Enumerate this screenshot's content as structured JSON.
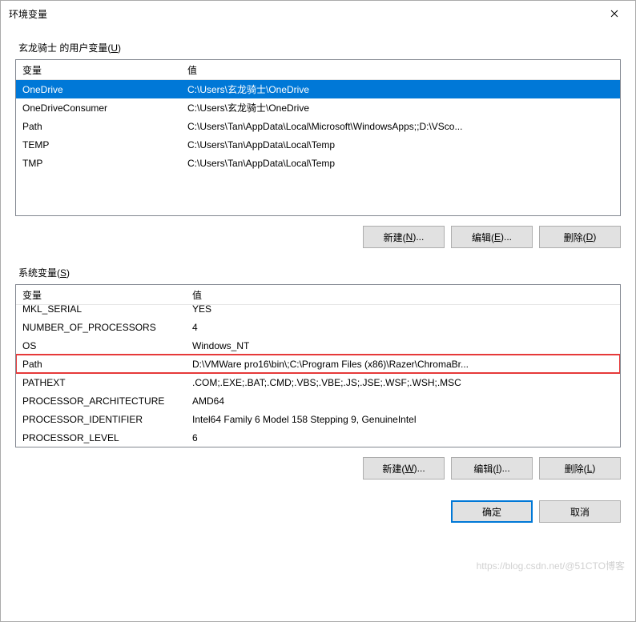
{
  "window": {
    "title": "环境变量"
  },
  "user_section": {
    "label_prefix": "玄龙骑士 的用户变量(",
    "label_hotkey": "U",
    "label_suffix": ")",
    "columns": {
      "var": "变量",
      "val": "值"
    },
    "rows": [
      {
        "var": "OneDrive",
        "val": "C:\\Users\\玄龙骑士\\OneDrive",
        "selected": true
      },
      {
        "var": "OneDriveConsumer",
        "val": "C:\\Users\\玄龙骑士\\OneDrive"
      },
      {
        "var": "Path",
        "val": "C:\\Users\\Tan\\AppData\\Local\\Microsoft\\WindowsApps;;D:\\VSco..."
      },
      {
        "var": "TEMP",
        "val": "C:\\Users\\Tan\\AppData\\Local\\Temp"
      },
      {
        "var": "TMP",
        "val": "C:\\Users\\Tan\\AppData\\Local\\Temp"
      }
    ],
    "buttons": {
      "new": {
        "text": "新建(",
        "hk": "N",
        "tail": ")..."
      },
      "edit": {
        "text": "编辑(",
        "hk": "E",
        "tail": ")..."
      },
      "del": {
        "text": "删除(",
        "hk": "D",
        "tail": ")"
      }
    }
  },
  "system_section": {
    "label_prefix": "系统变量(",
    "label_hotkey": "S",
    "label_suffix": ")",
    "columns": {
      "var": "变量",
      "val": "值"
    },
    "rows": [
      {
        "var": "MKL_SERIAL",
        "val": "YES"
      },
      {
        "var": "NUMBER_OF_PROCESSORS",
        "val": "4"
      },
      {
        "var": "OS",
        "val": "Windows_NT"
      },
      {
        "var": "Path",
        "val": "D:\\VMWare pro16\\bin\\;C:\\Program Files (x86)\\Razer\\ChromaBr...",
        "highlighted": true
      },
      {
        "var": "PATHEXT",
        "val": ".COM;.EXE;.BAT;.CMD;.VBS;.VBE;.JS;.JSE;.WSF;.WSH;.MSC"
      },
      {
        "var": "PROCESSOR_ARCHITECTURE",
        "val": "AMD64"
      },
      {
        "var": "PROCESSOR_IDENTIFIER",
        "val": "Intel64 Family 6 Model 158 Stepping 9, GenuineIntel"
      },
      {
        "var": "PROCESSOR_LEVEL",
        "val": "6"
      }
    ],
    "buttons": {
      "new": {
        "text": "新建(",
        "hk": "W",
        "tail": ")..."
      },
      "edit": {
        "text": "编辑(",
        "hk": "I",
        "tail": ")..."
      },
      "del": {
        "text": "删除(",
        "hk": "L",
        "tail": ")"
      }
    }
  },
  "footer": {
    "ok": "确定",
    "cancel": "取消"
  },
  "watermark": "https://blog.csdn.net/@51CTO博客"
}
